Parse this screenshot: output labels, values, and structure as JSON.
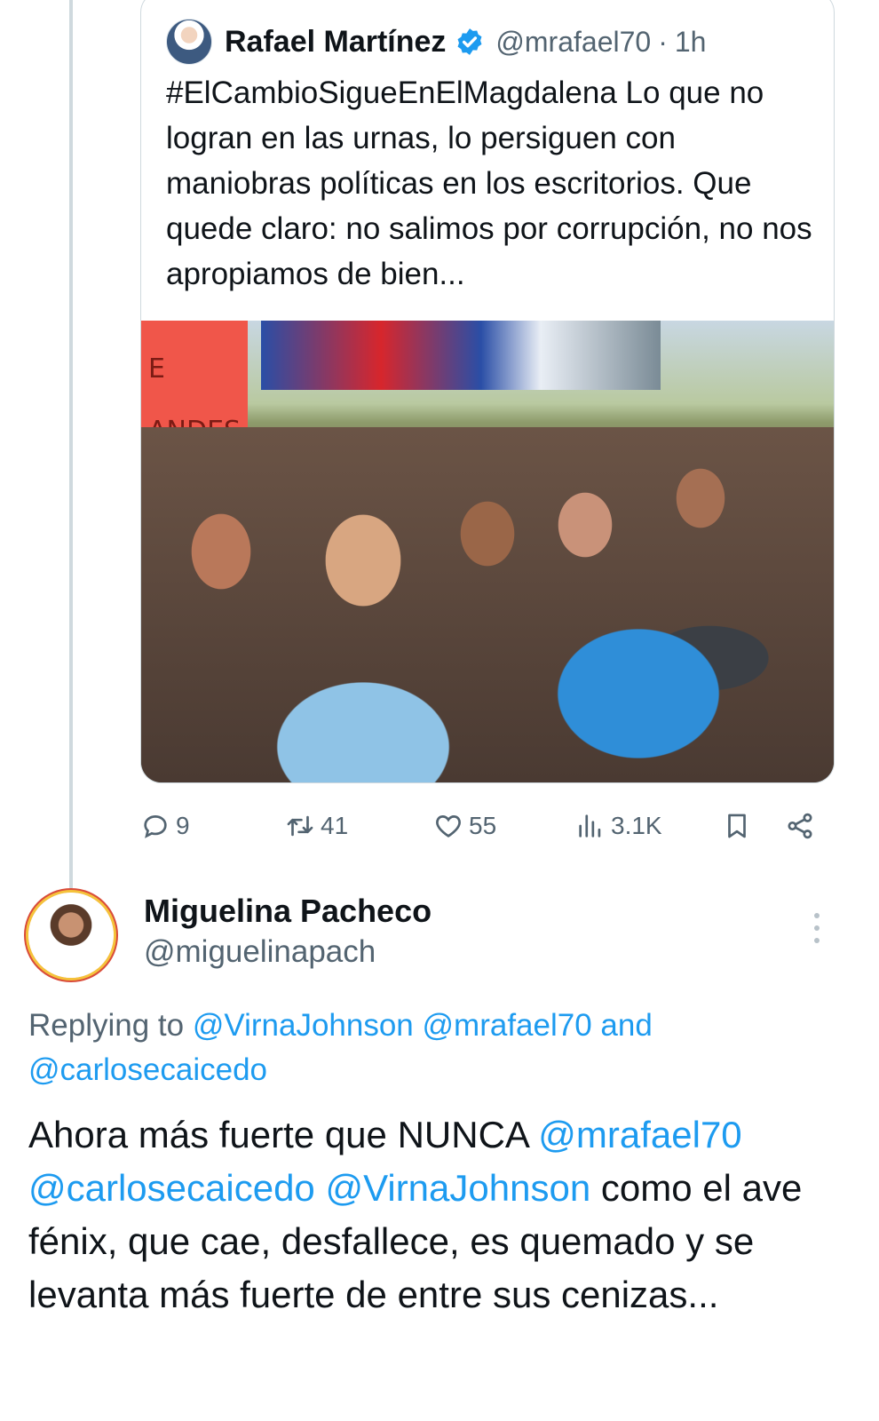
{
  "quoted_tweet": {
    "author_name": "Rafael Martínez",
    "handle": "@mrafael70",
    "separator": "·",
    "time": "1h",
    "text": "#ElCambioSigueEnElMagdalena Lo que no logran en las urnas, lo persiguen con maniobras políticas en los escritorios. Que quede claro: no salimos por corrupción, no nos apropiamos de bien...",
    "photo_sign_text_1": "E",
    "photo_sign_text_2": "ANDES",
    "actions": {
      "replies": "9",
      "retweets": "41",
      "likes": "55",
      "views": "3.1K"
    }
  },
  "reply": {
    "author_name": "Miguelina Pacheco",
    "handle": "@miguelinapach",
    "replying_prefix": "Replying to",
    "replying_mention_1": "@VirnaJohnson",
    "replying_mention_2": "@mrafael70",
    "replying_and": "and",
    "replying_mention_3": "@carlosecaicedo",
    "text_part_1": "Ahora más fuerte que NUNCA",
    "text_mention_1": "@mrafael70",
    "text_mention_2": "@carlosecaicedo",
    "text_mention_3": "@VirnaJohnson",
    "text_part_2": "como el ave fénix, que cae, desfallece, es quemado y se levanta más fuerte de entre sus cenizas..."
  },
  "colors": {
    "accent": "#1d9bf0",
    "secondary_text": "#536471",
    "primary_text": "#0f1419",
    "border": "#cfd9de"
  },
  "icons": [
    "verified-badge-icon",
    "reply-icon",
    "retweet-icon",
    "like-icon",
    "views-icon",
    "bookmark-icon",
    "share-icon",
    "more-options-icon"
  ]
}
